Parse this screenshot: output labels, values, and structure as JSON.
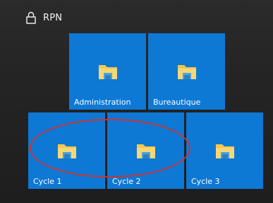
{
  "group": {
    "icon": "lock-icon",
    "title": "RPN"
  },
  "tiles": [
    {
      "label": "Administration",
      "icon": "folder-icon"
    },
    {
      "label": "Bureautique",
      "icon": "folder-icon"
    },
    {
      "label": "Cycle 1",
      "icon": "folder-icon"
    },
    {
      "label": "Cycle 2",
      "icon": "folder-icon"
    },
    {
      "label": "Cycle 3",
      "icon": "folder-icon"
    }
  ],
  "colors": {
    "tile": "#0e78d5",
    "background": "#242424",
    "highlight": "#cc3333",
    "folder": "#f2c94c"
  }
}
